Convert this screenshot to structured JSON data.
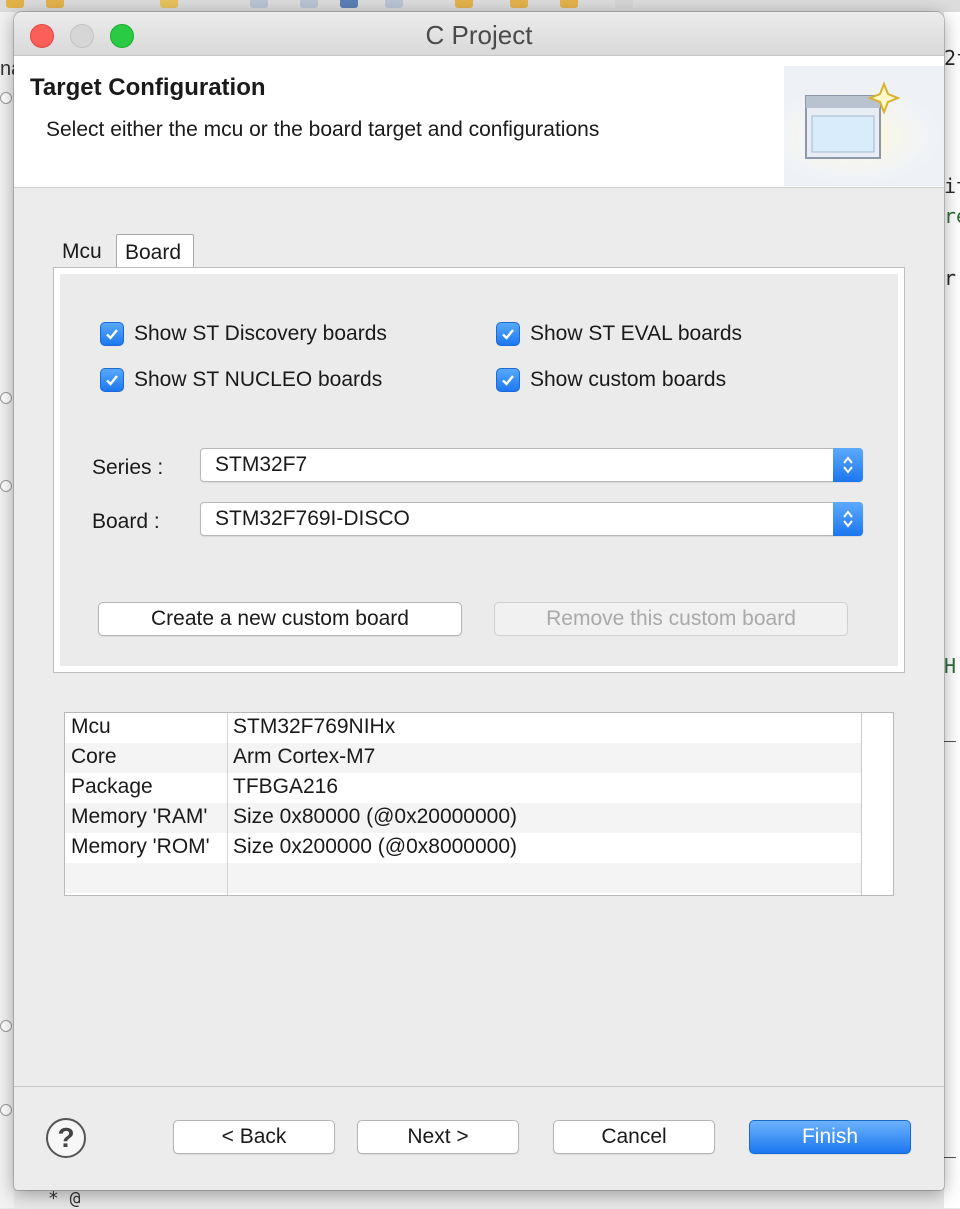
{
  "window": {
    "title": "C Project"
  },
  "header": {
    "title": "Target Configuration",
    "description": "Select either the mcu or the board target and configurations"
  },
  "tabs": [
    {
      "label": "Mcu",
      "selected": false
    },
    {
      "label": "Board",
      "selected": true
    }
  ],
  "board_tab": {
    "checkboxes": [
      {
        "label": "Show ST Discovery boards",
        "checked": true
      },
      {
        "label": "Show ST EVAL boards",
        "checked": true
      },
      {
        "label": "Show ST NUCLEO boards",
        "checked": true
      },
      {
        "label": "Show custom boards",
        "checked": true
      }
    ],
    "series": {
      "label": "Series :",
      "value": "STM32F7"
    },
    "board": {
      "label": "Board :",
      "value": "STM32F769I-DISCO"
    },
    "create_button": "Create a new custom board",
    "remove_button": "Remove this custom board"
  },
  "properties": [
    {
      "key": "Mcu",
      "value": "STM32F769NIHx"
    },
    {
      "key": "Core",
      "value": "Arm Cortex-M7"
    },
    {
      "key": "Package",
      "value": "TFBGA216"
    },
    {
      "key": "Memory 'RAM'",
      "value": "Size 0x80000 (@0x20000000)"
    },
    {
      "key": "Memory 'ROM'",
      "value": "Size 0x200000 (@0x8000000)"
    }
  ],
  "footer": {
    "help": "?",
    "back": "< Back",
    "next": "Next >",
    "cancel": "Cancel",
    "finish": "Finish"
  },
  "background_ide": {
    "left_text": "na",
    "right_text": [
      "2f",
      "it",
      "re",
      "r",
      "H",
      "_",
      "_"
    ],
    "bottom_text": "* @"
  },
  "colors": {
    "accent": "#1c78f0",
    "close": "#fc5f57",
    "maximize": "#2acb42"
  }
}
